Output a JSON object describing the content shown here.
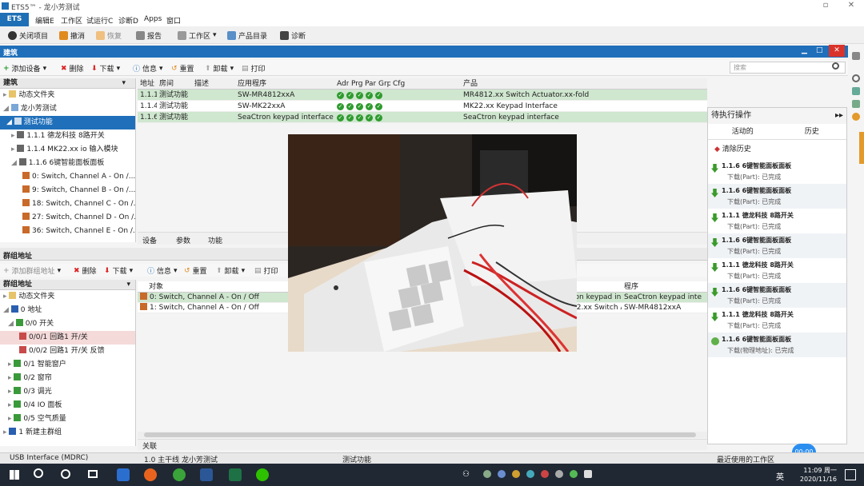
{
  "window": {
    "title": "ETS5™ - 龙小芳测试"
  },
  "menu": {
    "ets": "ETS",
    "items": [
      "编辑E",
      "工作区",
      "试运行C",
      "诊断D",
      "Apps",
      "窗口"
    ]
  },
  "toolbar": {
    "close_project": "关闭项目",
    "undo": "撤消",
    "redo": "恢复",
    "reports": "报告",
    "workspace": "工作区",
    "catalogs": "产品目录",
    "diagnostics": "诊断"
  },
  "buildings": {
    "title": "建筑",
    "toolbar": {
      "add_device": "添加设备",
      "delete": "删除",
      "download": "下载",
      "info": "信息",
      "reset": "重置",
      "unload": "卸载",
      "print": "打印"
    },
    "search_placeholder": "搜索",
    "tree_header": "建筑",
    "tree": [
      "动态文件夹",
      "龙小芳测试",
      "测试功能",
      "1.1.1 德龙科技 8路开关",
      "1.1.4 MK22.xx io 输入模块",
      "1.1.6 6键智能面板面板",
      "0: Switch, Channel A - On /...",
      "9: Switch, Channel B - On /...",
      "18: Switch, Channel C - On /...",
      "27: Switch, Channel D - On /...",
      "36: Switch, Channel E - On /..."
    ],
    "columns": [
      "地址",
      "房间",
      "描述",
      "应用程序",
      "Adr",
      "Prg",
      "Par",
      "Grp",
      "Cfg",
      "产品"
    ],
    "rows": [
      {
        "addr": "1.1.1",
        "room": "测试功能",
        "app": "SW-MR4812xxA",
        "product": "MR4812.xx Switch Actuator.xx-fold"
      },
      {
        "addr": "1.1.4",
        "room": "测试功能",
        "app": "SW-MK22xxA",
        "product": "MK22.xx Keypad Interface"
      },
      {
        "addr": "1.1.6",
        "room": "测试功能",
        "app": "SeaCtron keypad interface",
        "product": "SeaCtron keypad interface"
      }
    ],
    "tabs": [
      "设备",
      "参数",
      "功能"
    ]
  },
  "groups": {
    "title": "群组地址",
    "toolbar": {
      "add_group": "添加群组地址",
      "delete": "删除",
      "download": "下载",
      "info": "信息",
      "reset": "重置",
      "unload": "卸载",
      "print": "打印"
    },
    "tree_header": "群组地址",
    "tree": [
      "动态文件夹",
      "0 地址",
      "0/0 开关",
      "0/0/1 回路1 开/关",
      "0/0/2 回路1 开/关 反馈",
      "0/1 智能窗户",
      "0/2 窗帘",
      "0/3 调光",
      "0/4 IO 面板",
      "0/5 空气质量",
      "1 新建主群组"
    ],
    "columns": [
      "对象",
      "程序"
    ],
    "rows": [
      {
        "object": "0: Switch, Channel A - On / Off",
        "device": "ron keypad in...",
        "program": "SeaCtron keypad interface"
      },
      {
        "object": "1: Switch, Channel A - On / Off",
        "device": "12.xx Switch A...",
        "program": "SW-MR4812xxA"
      }
    ],
    "bottom_tab": "关联"
  },
  "pending": {
    "title": "待执行操作",
    "tabs": [
      "活动的",
      "历史"
    ],
    "clear": "清除历史",
    "items": [
      {
        "name": "1.1.6 6键智能面板面板",
        "status": "下载(Part): 已完成"
      },
      {
        "name": "1.1.6 6键智能面板面板",
        "status": "下载(Part): 已完成"
      },
      {
        "name": "1.1.1 德龙科技 8路开关",
        "status": "下载(Part): 已完成"
      },
      {
        "name": "1.1.6 6键智能面板面板",
        "status": "下载(Part): 已完成"
      },
      {
        "name": "1.1.1 德龙科技 8路开关",
        "status": "下载(Part): 已完成"
      },
      {
        "name": "1.1.6 6键智能面板面板",
        "status": "下载(Part): 已完成"
      },
      {
        "name": "1.1.1 德龙科技 8路开关",
        "status": "下载(Part): 已完成"
      },
      {
        "name": "1.1.6 6键智能面板面板",
        "status": "下载(物理地址): 已完成"
      }
    ]
  },
  "statusbar": {
    "interface": "USB Interface (MDRC)",
    "line": "1.0 主干线 龙小芳测试",
    "mode": "测试功能",
    "recent": "最近使用的工作区"
  },
  "taskbar": {
    "time": "11:09 周一",
    "date": "2020/11/16",
    "lang": "英",
    "badge": "00:00"
  }
}
